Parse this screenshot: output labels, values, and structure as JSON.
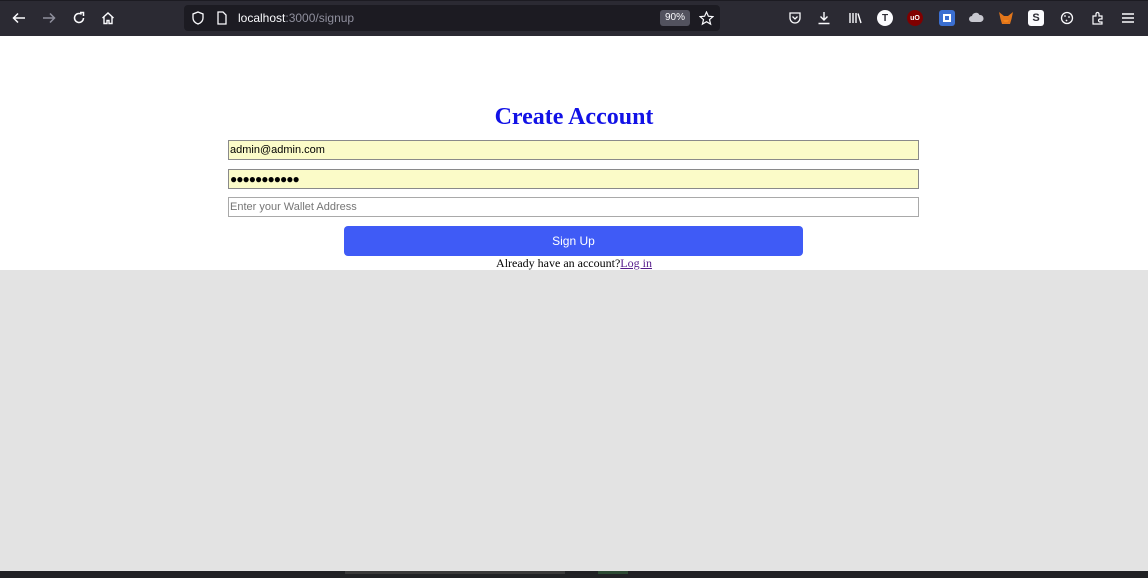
{
  "browser": {
    "url_host": "localhost",
    "url_path": ":3000/signup",
    "zoom": "90%",
    "icons": [
      "back-icon",
      "forward-icon",
      "reload-icon",
      "home-icon",
      "shield-icon",
      "page-icon",
      "bookmark-star-icon",
      "pocket-icon",
      "download-icon",
      "library-icon",
      "extension-t-icon",
      "ublock-icon",
      "extension-blue-icon",
      "extension-cloud-icon",
      "metamask-icon",
      "extension-s-icon",
      "extension-cookie-icon",
      "extensions-puzzle-icon",
      "menu-icon"
    ],
    "ext_t_label": "T",
    "ext_ublock_label": "uO",
    "ext_s_label": "S"
  },
  "form": {
    "title": "Create Account",
    "email_value": "admin@admin.com",
    "password_mask": "●●●●●●●●●●●",
    "wallet_placeholder": "Enter your Wallet Address",
    "signup_label": "Sign Up",
    "login_prompt": "Already have an account?",
    "login_link": "Log in"
  },
  "colors": {
    "title": "#1212e6",
    "button": "#3f5bf6",
    "autofill": "#fbfbc8"
  }
}
